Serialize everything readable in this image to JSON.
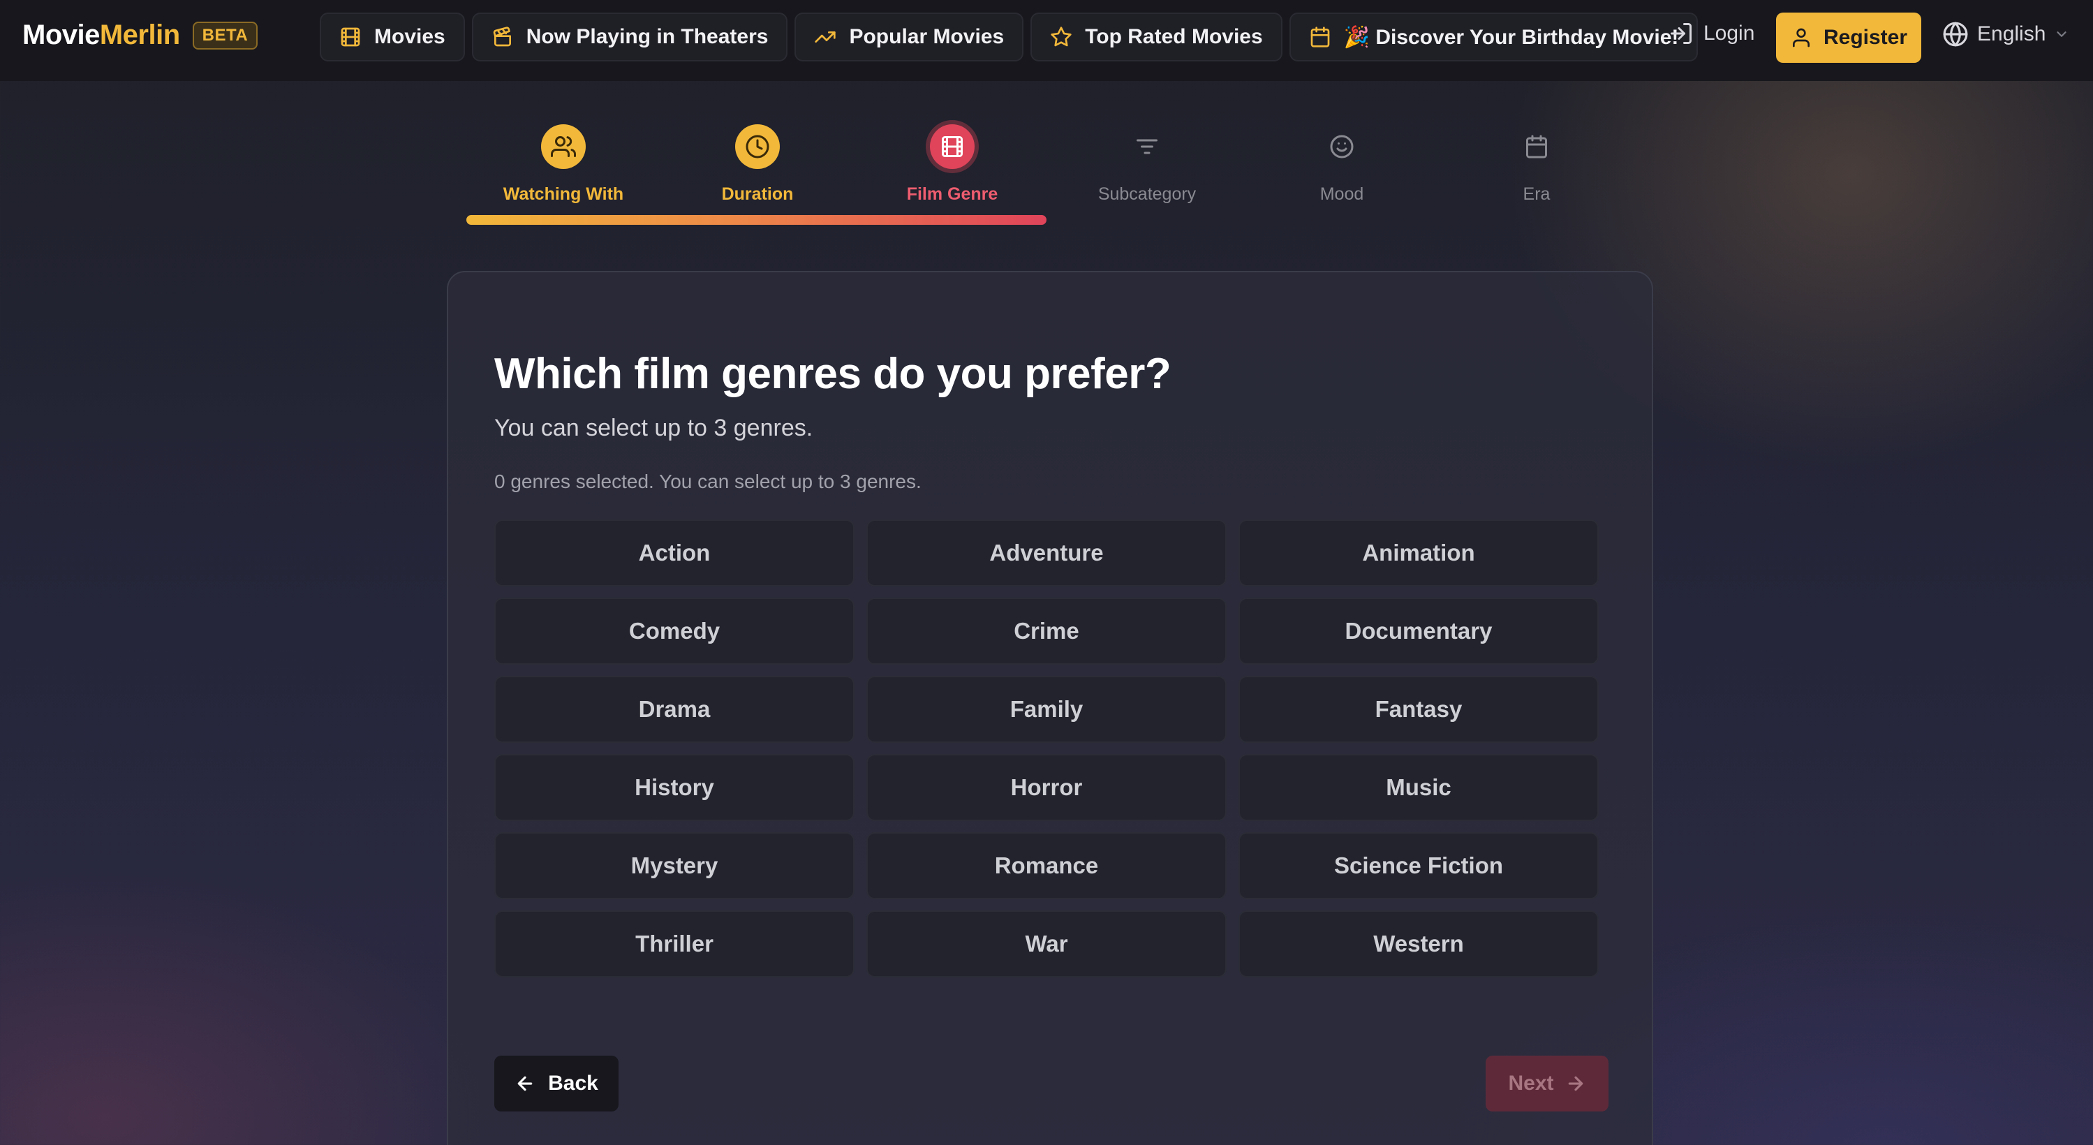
{
  "header": {
    "brand_part1": "Movie",
    "brand_part2": "Merlin",
    "beta_badge": "BETA",
    "nav": [
      {
        "label": "Movies",
        "icon": "film-icon"
      },
      {
        "label": "Now Playing in Theaters",
        "icon": "ticket-icon"
      },
      {
        "label": "Popular Movies",
        "icon": "trending-up-icon"
      },
      {
        "label": "Top Rated Movies",
        "icon": "star-icon"
      },
      {
        "label": "🎉 Discover Your Birthday Movie!",
        "icon": "calendar-icon"
      }
    ],
    "login_label": "Login",
    "register_label": "Register",
    "language": "English"
  },
  "stepper": {
    "progress_fraction": 0.5,
    "steps": [
      {
        "label": "Watching With",
        "state": "done",
        "icon": "users-icon"
      },
      {
        "label": "Duration",
        "state": "done",
        "icon": "clock-icon"
      },
      {
        "label": "Film Genre",
        "state": "active",
        "icon": "film-icon"
      },
      {
        "label": "Subcategory",
        "state": "todo",
        "icon": "filter-icon"
      },
      {
        "label": "Mood",
        "state": "todo",
        "icon": "smile-icon"
      },
      {
        "label": "Era",
        "state": "todo",
        "icon": "calendar-icon"
      }
    ]
  },
  "question": {
    "title": "Which film genres do you prefer?",
    "subtitle": "You can select up to 3 genres.",
    "count_text": "0 genres selected. You can select up to 3 genres."
  },
  "genres": [
    "Action",
    "Adventure",
    "Animation",
    "Comedy",
    "Crime",
    "Documentary",
    "Drama",
    "Family",
    "Fantasy",
    "History",
    "Horror",
    "Music",
    "Mystery",
    "Romance",
    "Science Fiction",
    "Thriller",
    "War",
    "Western"
  ],
  "footer": {
    "back_label": "Back",
    "next_label": "Next"
  },
  "colors": {
    "accent": "#f2b83a",
    "active_step": "#e0445a",
    "next_disabled": "#5e2a3a"
  }
}
